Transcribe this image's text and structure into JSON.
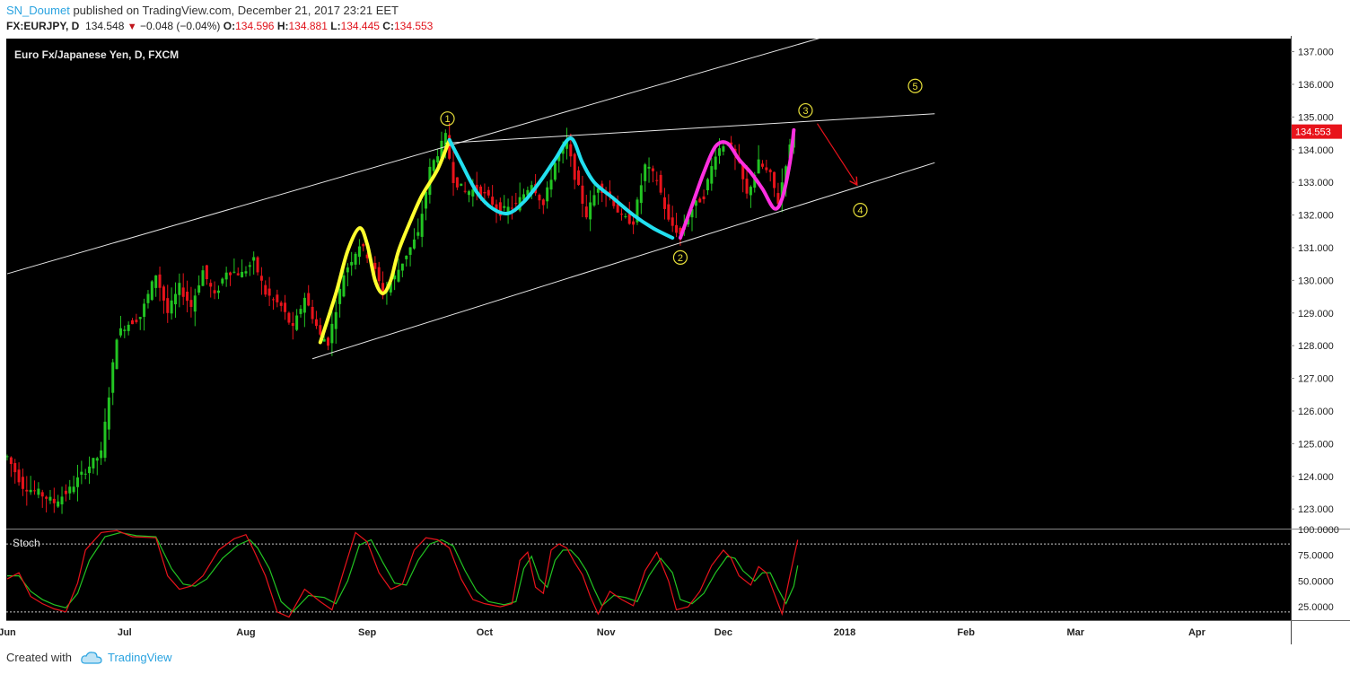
{
  "header": {
    "author": "SN_Doumet",
    "published_text": "published on TradingView.com, December 21, 2017 23:21 EET",
    "symbol": "FX:EURJPY, D",
    "last": "134.548",
    "change": "−0.048 (−0.04%)",
    "open_label": "O:",
    "open": "134.596",
    "high_label": "H:",
    "high": "134.881",
    "low_label": "L:",
    "low": "134.445",
    "close_label": "C:",
    "close": "134.553"
  },
  "footer": {
    "created_with": "Created with",
    "brand": "TradingView"
  },
  "colors": {
    "background": "#000000",
    "up_candle": "#22c422",
    "down_candle": "#e8131b",
    "wave_yellow": "#ffff2e",
    "wave_cyan": "#22e0f0",
    "wave_magenta": "#ff2fe0",
    "annotation": "#e8e03a",
    "stoch_k": "#e8131b",
    "stoch_d": "#22c422"
  },
  "chart_data": {
    "type": "candlestick",
    "title": "Euro Fx/Japanese Yen, D, FXCM",
    "ylim": [
      122.4,
      137.4
    ],
    "y_ticks": [
      "137.000",
      "136.000",
      "135.000",
      "134.000",
      "133.000",
      "132.000",
      "131.000",
      "130.000",
      "129.000",
      "128.000",
      "127.000",
      "126.000",
      "125.000",
      "124.000",
      "123.000"
    ],
    "x_ticks": [
      {
        "label": "Jun",
        "day": 0
      },
      {
        "label": "Jul",
        "day": 30
      },
      {
        "label": "Aug",
        "day": 61
      },
      {
        "label": "Sep",
        "day": 92
      },
      {
        "label": "Oct",
        "day": 122
      },
      {
        "label": "Nov",
        "day": 153
      },
      {
        "label": "Dec",
        "day": 183
      },
      {
        "label": "2018",
        "day": 214
      },
      {
        "label": "Feb",
        "day": 245
      },
      {
        "label": "Mar",
        "day": 273
      },
      {
        "label": "Apr",
        "day": 304
      }
    ],
    "price_label": "134.553",
    "last_price": 134.553,
    "anchors": [
      [
        0,
        124.6
      ],
      [
        4,
        123.7
      ],
      [
        8,
        123.5
      ],
      [
        12,
        123.2
      ],
      [
        16,
        123.6
      ],
      [
        20,
        124.2
      ],
      [
        24,
        124.7
      ],
      [
        26,
        126.5
      ],
      [
        28,
        128.3
      ],
      [
        30,
        128.6
      ],
      [
        34,
        128.9
      ],
      [
        38,
        130.2
      ],
      [
        41,
        129.0
      ],
      [
        44,
        129.8
      ],
      [
        47,
        129.2
      ],
      [
        50,
        130.3
      ],
      [
        53,
        129.5
      ],
      [
        56,
        130.3
      ],
      [
        60,
        130.2
      ],
      [
        63,
        130.6
      ],
      [
        66,
        129.6
      ],
      [
        70,
        129.2
      ],
      [
        73,
        128.5
      ],
      [
        76,
        129.5
      ],
      [
        80,
        128.3
      ],
      [
        82,
        128.1
      ],
      [
        86,
        130.2
      ],
      [
        90,
        131.1
      ],
      [
        93,
        130.6
      ],
      [
        96,
        129.6
      ],
      [
        99,
        130.1
      ],
      [
        102,
        130.8
      ],
      [
        105,
        131.4
      ],
      [
        108,
        133.4
      ],
      [
        112,
        134.4
      ],
      [
        114,
        133.1
      ],
      [
        117,
        132.7
      ],
      [
        120,
        132.8
      ],
      [
        123,
        132.5
      ],
      [
        126,
        132.1
      ],
      [
        130,
        132.3
      ],
      [
        134,
        133.0
      ],
      [
        137,
        132.3
      ],
      [
        140,
        133.6
      ],
      [
        143,
        134.2
      ],
      [
        145,
        133.2
      ],
      [
        148,
        132.0
      ],
      [
        151,
        132.9
      ],
      [
        154,
        132.6
      ],
      [
        157,
        131.9
      ],
      [
        160,
        131.8
      ],
      [
        163,
        133.5
      ],
      [
        166,
        133.1
      ],
      [
        169,
        131.8
      ],
      [
        172,
        131.4
      ],
      [
        175,
        132.2
      ],
      [
        178,
        132.6
      ],
      [
        181,
        133.9
      ],
      [
        184,
        134.3
      ],
      [
        187,
        133.5
      ],
      [
        189,
        132.6
      ],
      [
        192,
        133.6
      ],
      [
        195,
        133.2
      ],
      [
        197,
        132.4
      ],
      [
        199,
        133.6
      ],
      [
        201,
        134.553
      ]
    ],
    "channel_upper": {
      "start": [
        0,
        130.2
      ],
      "end": [
        213,
        137.6
      ]
    },
    "channel_lower": {
      "start": [
        78,
        127.6
      ],
      "end": [
        237,
        133.6
      ]
    },
    "resistance": {
      "start": [
        112,
        134.2
      ],
      "end": [
        237,
        135.1
      ]
    },
    "waves": [
      {
        "color": "yellow",
        "points": [
          [
            80,
            128.1
          ],
          [
            84,
            129.6
          ],
          [
            87,
            130.9
          ],
          [
            90,
            131.6
          ],
          [
            92,
            131.1
          ],
          [
            94,
            130.0
          ],
          [
            96,
            129.6
          ],
          [
            98,
            130.0
          ],
          [
            100,
            130.9
          ],
          [
            103,
            131.8
          ],
          [
            106,
            132.6
          ],
          [
            110,
            133.4
          ],
          [
            113,
            134.3
          ]
        ]
      },
      {
        "color": "cyan",
        "points": [
          [
            113,
            134.3
          ],
          [
            116,
            133.6
          ],
          [
            120,
            132.7
          ],
          [
            124,
            132.2
          ],
          [
            128,
            132.05
          ],
          [
            132,
            132.4
          ],
          [
            136,
            133.0
          ],
          [
            140,
            133.7
          ],
          [
            144,
            134.35
          ],
          [
            147,
            133.6
          ],
          [
            150,
            133.0
          ],
          [
            155,
            132.5
          ],
          [
            160,
            132.0
          ],
          [
            165,
            131.6
          ],
          [
            170,
            131.3
          ]
        ]
      },
      {
        "color": "magenta",
        "points": [
          [
            172,
            131.3
          ],
          [
            175,
            132.3
          ],
          [
            178,
            133.3
          ],
          [
            181,
            134.1
          ],
          [
            184,
            134.2
          ],
          [
            187,
            133.7
          ],
          [
            190,
            133.3
          ],
          [
            193,
            132.8
          ],
          [
            196,
            132.2
          ],
          [
            198,
            132.5
          ],
          [
            200,
            133.6
          ],
          [
            201,
            134.6
          ]
        ]
      }
    ],
    "labels": [
      {
        "text": "1",
        "x": 112.5,
        "y": 134.95
      },
      {
        "text": "2",
        "x": 172,
        "y": 130.7
      },
      {
        "text": "3",
        "x": 204,
        "y": 135.2
      },
      {
        "text": "4",
        "x": 218,
        "y": 132.15
      },
      {
        "text": "5",
        "x": 232,
        "y": 135.95
      }
    ],
    "arrow": {
      "from": [
        207,
        134.8
      ],
      "to": [
        217,
        132.95
      ]
    },
    "stoch": {
      "label": "Stoch",
      "ylim": [
        12,
        100
      ],
      "y_ticks": [
        "100.0000",
        "75.0000",
        "50.0000",
        "25.0000"
      ],
      "overbought": 86,
      "oversold": 20,
      "k_anchors": [
        [
          0,
          52
        ],
        [
          3,
          58
        ],
        [
          6,
          35
        ],
        [
          9,
          28
        ],
        [
          12,
          23
        ],
        [
          15,
          20
        ],
        [
          18,
          48
        ],
        [
          20,
          80
        ],
        [
          24,
          97
        ],
        [
          28,
          99
        ],
        [
          32,
          93
        ],
        [
          38,
          92
        ],
        [
          41,
          55
        ],
        [
          44,
          42
        ],
        [
          47,
          45
        ],
        [
          50,
          55
        ],
        [
          54,
          80
        ],
        [
          58,
          91
        ],
        [
          61,
          95
        ],
        [
          63,
          80
        ],
        [
          66,
          55
        ],
        [
          69,
          20
        ],
        [
          72,
          15
        ],
        [
          76,
          42
        ],
        [
          80,
          30
        ],
        [
          83,
          22
        ],
        [
          86,
          60
        ],
        [
          89,
          97
        ],
        [
          92,
          88
        ],
        [
          95,
          58
        ],
        [
          98,
          42
        ],
        [
          101,
          47
        ],
        [
          104,
          80
        ],
        [
          107,
          92
        ],
        [
          110,
          90
        ],
        [
          113,
          82
        ],
        [
          116,
          52
        ],
        [
          119,
          32
        ],
        [
          122,
          28
        ],
        [
          126,
          25
        ],
        [
          129,
          28
        ],
        [
          131,
          70
        ],
        [
          133,
          78
        ],
        [
          135,
          44
        ],
        [
          137,
          38
        ],
        [
          139,
          80
        ],
        [
          141,
          86
        ],
        [
          143,
          82
        ],
        [
          145,
          68
        ],
        [
          147,
          56
        ],
        [
          149,
          35
        ],
        [
          151,
          18
        ],
        [
          154,
          40
        ],
        [
          157,
          32
        ],
        [
          160,
          26
        ],
        [
          163,
          60
        ],
        [
          166,
          78
        ],
        [
          169,
          50
        ],
        [
          171,
          22
        ],
        [
          174,
          25
        ],
        [
          177,
          40
        ],
        [
          180,
          65
        ],
        [
          183,
          80
        ],
        [
          185,
          72
        ],
        [
          187,
          55
        ],
        [
          190,
          46
        ],
        [
          192,
          64
        ],
        [
          194,
          58
        ],
        [
          196,
          38
        ],
        [
          198,
          18
        ],
        [
          200,
          55
        ],
        [
          202,
          90
        ]
      ],
      "d_anchors": [
        [
          0,
          55
        ],
        [
          3,
          55
        ],
        [
          6,
          40
        ],
        [
          9,
          32
        ],
        [
          12,
          27
        ],
        [
          15,
          24
        ],
        [
          18,
          38
        ],
        [
          21,
          70
        ],
        [
          25,
          93
        ],
        [
          29,
          97
        ],
        [
          33,
          94
        ],
        [
          38,
          93
        ],
        [
          42,
          62
        ],
        [
          45,
          47
        ],
        [
          48,
          45
        ],
        [
          51,
          52
        ],
        [
          55,
          72
        ],
        [
          59,
          85
        ],
        [
          62,
          90
        ],
        [
          64,
          82
        ],
        [
          67,
          62
        ],
        [
          70,
          30
        ],
        [
          73,
          20
        ],
        [
          77,
          36
        ],
        [
          81,
          34
        ],
        [
          84,
          28
        ],
        [
          87,
          50
        ],
        [
          90,
          85
        ],
        [
          93,
          90
        ],
        [
          96,
          68
        ],
        [
          99,
          48
        ],
        [
          102,
          46
        ],
        [
          105,
          70
        ],
        [
          108,
          86
        ],
        [
          111,
          90
        ],
        [
          114,
          84
        ],
        [
          117,
          60
        ],
        [
          120,
          40
        ],
        [
          123,
          30
        ],
        [
          127,
          27
        ],
        [
          130,
          30
        ],
        [
          132,
          62
        ],
        [
          134,
          74
        ],
        [
          136,
          52
        ],
        [
          138,
          44
        ],
        [
          140,
          70
        ],
        [
          142,
          80
        ],
        [
          144,
          80
        ],
        [
          146,
          72
        ],
        [
          148,
          60
        ],
        [
          150,
          42
        ],
        [
          152,
          26
        ],
        [
          155,
          36
        ],
        [
          158,
          34
        ],
        [
          161,
          30
        ],
        [
          164,
          55
        ],
        [
          167,
          72
        ],
        [
          170,
          58
        ],
        [
          172,
          32
        ],
        [
          175,
          28
        ],
        [
          178,
          38
        ],
        [
          181,
          58
        ],
        [
          184,
          74
        ],
        [
          186,
          72
        ],
        [
          188,
          60
        ],
        [
          191,
          50
        ],
        [
          193,
          58
        ],
        [
          195,
          58
        ],
        [
          197,
          42
        ],
        [
          199,
          28
        ],
        [
          201,
          45
        ],
        [
          202,
          65
        ]
      ]
    }
  }
}
